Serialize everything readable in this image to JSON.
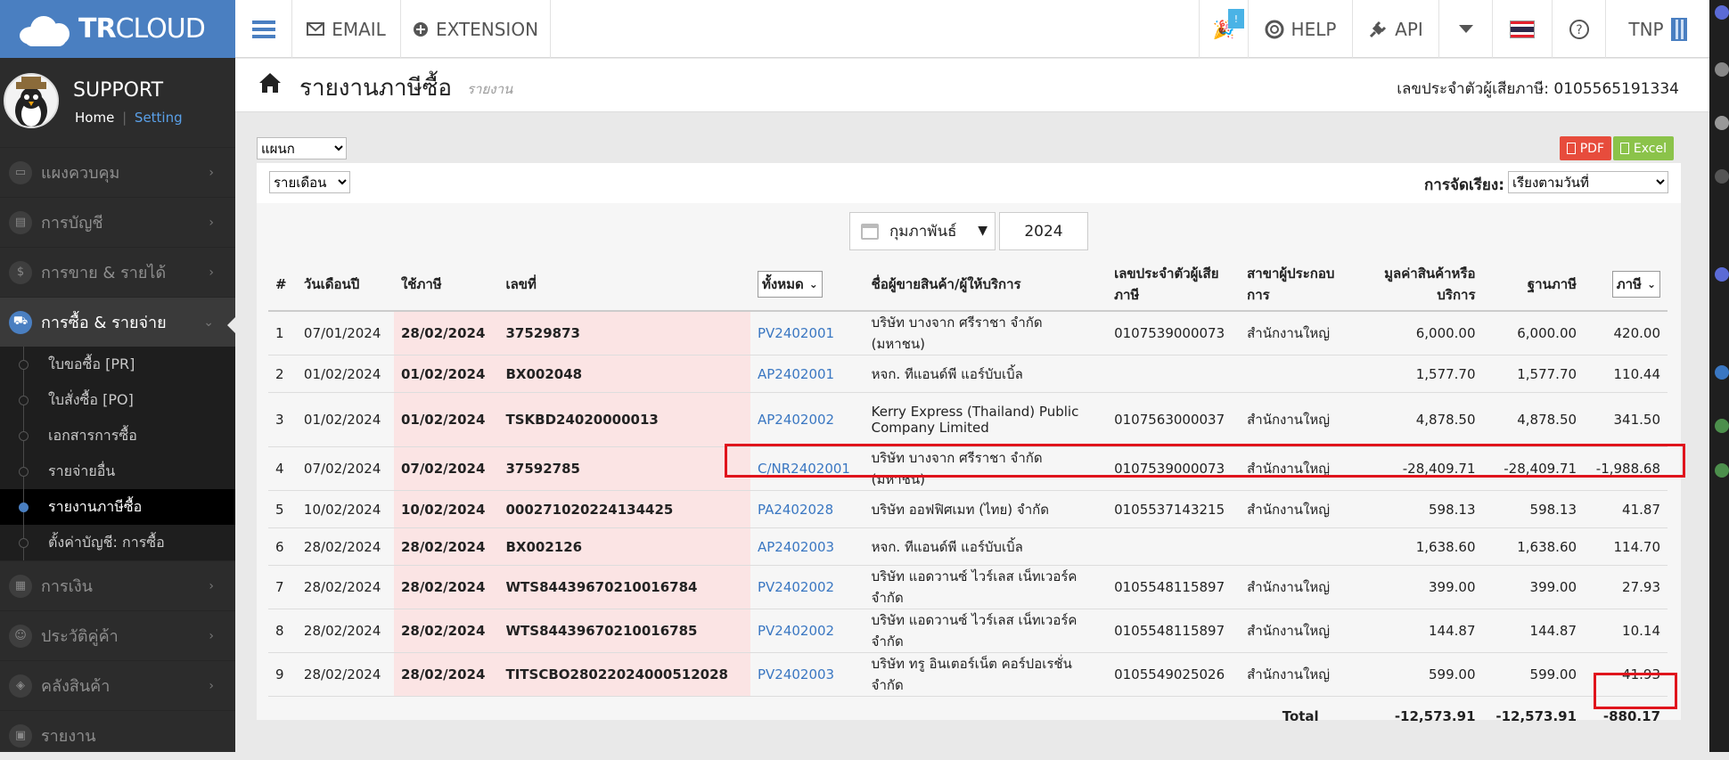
{
  "brand": {
    "tr": "TR",
    "cloud": "CLOUD"
  },
  "topnav": {
    "menu_icon": "hamburger-icon",
    "email": "EMAIL",
    "extension": "EXTENSION",
    "notification_badge": "!",
    "help": "HELP",
    "api": "API",
    "user": "TNP"
  },
  "profile": {
    "name": "SUPPORT",
    "home": "Home",
    "separator": "|",
    "setting": "Setting"
  },
  "sidebar": {
    "items": [
      {
        "label": "แผงควบคุม",
        "icon": "monitor-icon"
      },
      {
        "label": "การบัญชี",
        "icon": "book-icon"
      },
      {
        "label": "การขาย & รายได้",
        "icon": "dollar-icon"
      },
      {
        "label": "การซื้อ & รายจ่าย",
        "icon": "cart-icon",
        "active": true
      },
      {
        "label": "การเงิน",
        "icon": "calculator-icon"
      },
      {
        "label": "ประวัติคู่ค้า",
        "icon": "contact-icon"
      },
      {
        "label": "คลังสินค้า",
        "icon": "boxes-icon"
      },
      {
        "label": "รายงาน",
        "icon": "report-icon"
      }
    ],
    "subitems": [
      {
        "label": "ใบขอซื้อ [PR]"
      },
      {
        "label": "ใบสั่งซื้อ [PO]"
      },
      {
        "label": "เอกสารการซื้อ"
      },
      {
        "label": "รายจ่ายอื่น"
      },
      {
        "label": "รายงานภาษีซื้อ",
        "active": true
      },
      {
        "label": "ตั้งค่าบัญชี: การซื้อ"
      }
    ]
  },
  "header": {
    "title": "รายงานภาษีซื้อ",
    "subtitle": "รายงาน",
    "taxid_label": "เลขประจำตัวผู้เสียภาษี:",
    "taxid_value": "0105565191334"
  },
  "filters": {
    "department": "แผนก",
    "period": "รายเดือน",
    "sort_label": "การจัดเรียง:",
    "sort_value": "เรียงตามวันที่",
    "month": "กุมภาพันธ์",
    "year": "2024",
    "pdf": "PDF",
    "excel": "Excel"
  },
  "table": {
    "headers": {
      "num": "#",
      "date": "วันเดือนปี",
      "tax_use": "ใช้ภาษี",
      "doc_no": "เลขที่",
      "filter_all": "ทั้งหมด",
      "vendor": "ชื่อผู้ขายสินค้า/ผู้ให้บริการ",
      "vendor_taxid": "เลขประจำตัวผู้เสียภาษี",
      "branch": "สาขาผู้ประกอบการ",
      "amount": "มูลค่าสินค้าหรือบริการ",
      "base": "ฐานภาษี",
      "tax": "ภาษี"
    },
    "rows": [
      {
        "n": "1",
        "date": "07/01/2024",
        "use": "28/02/2024",
        "no": "37529873",
        "doc": "PV2402001",
        "vendor": "บริษัท บางจาก ศรีราชา จำกัด (มหาชน)",
        "taxid": "0107539000073",
        "branch": "สำนักงานใหญ่",
        "amount": "6,000.00",
        "base": "6,000.00",
        "tax": "420.00"
      },
      {
        "n": "2",
        "date": "01/02/2024",
        "use": "01/02/2024",
        "no": "BX002048",
        "doc": "AP2402001",
        "vendor": "หจก. ทีแอนด์พี แอร์บับเบิ้ล",
        "taxid": "",
        "branch": "",
        "amount": "1,577.70",
        "base": "1,577.70",
        "tax": "110.44"
      },
      {
        "n": "3",
        "date": "01/02/2024",
        "use": "01/02/2024",
        "no": "TSKBD24020000013",
        "doc": "AP2402002",
        "vendor": "Kerry Express (Thailand) Public Company Limited",
        "taxid": "0107563000037",
        "branch": "สำนักงานใหญ่",
        "amount": "4,878.50",
        "base": "4,878.50",
        "tax": "341.50"
      },
      {
        "n": "4",
        "date": "07/02/2024",
        "use": "07/02/2024",
        "no": "37592785",
        "doc": "C/NR2402001",
        "vendor": "บริษัท บางจาก ศรีราชา จำกัด (มหาชน)",
        "taxid": "0107539000073",
        "branch": "สำนักงานใหญ่",
        "amount": "-28,409.71",
        "base": "-28,409.71",
        "tax": "-1,988.68"
      },
      {
        "n": "5",
        "date": "10/02/2024",
        "use": "10/02/2024",
        "no": "000271020224134425",
        "doc": "PA2402028",
        "vendor": "บริษัท ออฟฟิศเมท (ไทย) จำกัด",
        "taxid": "0105537143215",
        "branch": "สำนักงานใหญ่",
        "amount": "598.13",
        "base": "598.13",
        "tax": "41.87"
      },
      {
        "n": "6",
        "date": "28/02/2024",
        "use": "28/02/2024",
        "no": "BX002126",
        "doc": "AP2402003",
        "vendor": "หจก. ทีแอนด์พี แอร์บับเบิ้ล",
        "taxid": "",
        "branch": "",
        "amount": "1,638.60",
        "base": "1,638.60",
        "tax": "114.70"
      },
      {
        "n": "7",
        "date": "28/02/2024",
        "use": "28/02/2024",
        "no": "WTS84439670210016784",
        "doc": "PV2402002",
        "vendor": "บริษัท แอดวานซ์ ไวร์เลส เน็ทเวอร์ค จำกัด",
        "taxid": "0105548115897",
        "branch": "สำนักงานใหญ่",
        "amount": "399.00",
        "base": "399.00",
        "tax": "27.93"
      },
      {
        "n": "8",
        "date": "28/02/2024",
        "use": "28/02/2024",
        "no": "WTS84439670210016785",
        "doc": "PV2402002",
        "vendor": "บริษัท แอดวานซ์ ไวร์เลส เน็ทเวอร์ค จำกัด",
        "taxid": "0105548115897",
        "branch": "สำนักงานใหญ่",
        "amount": "144.87",
        "base": "144.87",
        "tax": "10.14"
      },
      {
        "n": "9",
        "date": "28/02/2024",
        "use": "28/02/2024",
        "no": "TITSCBO28022024000512028",
        "doc": "PV2402003",
        "vendor": "บริษัท ทรู อินเตอร์เน็ต คอร์ปอเรชั่น จำกัด",
        "taxid": "0105549025026",
        "branch": "สำนักงานใหญ่",
        "amount": "599.00",
        "base": "599.00",
        "tax": "41.93"
      }
    ],
    "total": {
      "label": "Total",
      "amount": "-12,573.91",
      "base": "-12,573.91",
      "tax": "-880.17"
    }
  },
  "colors": {
    "brand_blue": "#4a7fc1",
    "link": "#3a77c2",
    "highlight": "#e0141c",
    "pdf": "#e74c3c",
    "excel": "#8bc34a"
  }
}
